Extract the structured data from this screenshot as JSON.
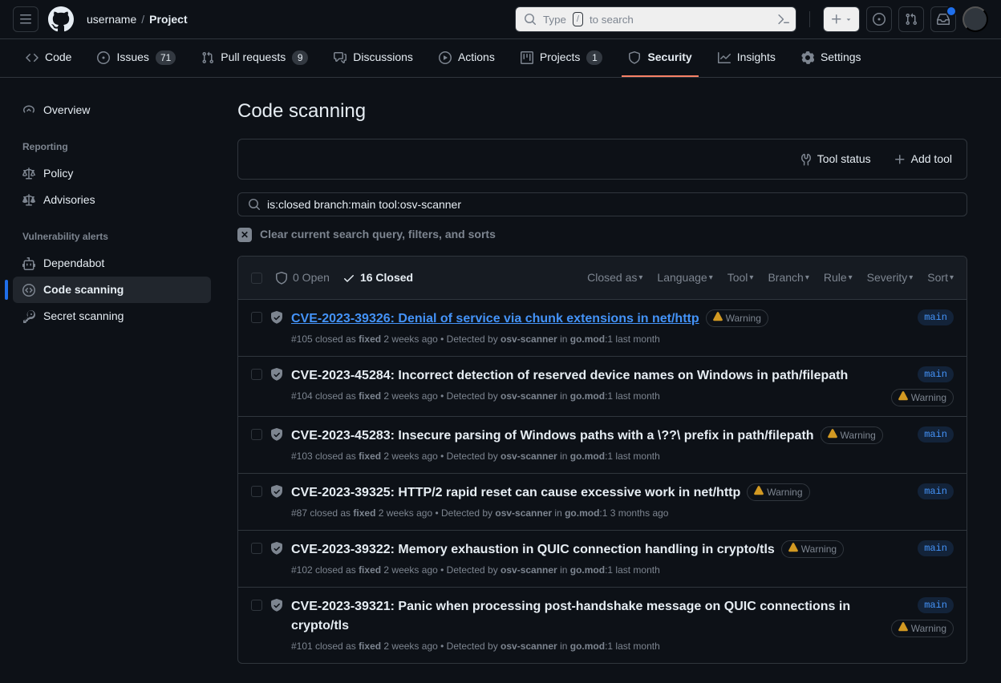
{
  "header": {
    "owner": "username",
    "repo": "Project",
    "search_prefix": "Type",
    "search_kbd": "/",
    "search_suffix": "to search"
  },
  "repoNav": [
    {
      "label": "Code",
      "count": null,
      "icon": "code"
    },
    {
      "label": "Issues",
      "count": "71",
      "icon": "issue"
    },
    {
      "label": "Pull requests",
      "count": "9",
      "icon": "pr"
    },
    {
      "label": "Discussions",
      "count": null,
      "icon": "discuss"
    },
    {
      "label": "Actions",
      "count": null,
      "icon": "play"
    },
    {
      "label": "Projects",
      "count": "1",
      "icon": "project"
    },
    {
      "label": "Security",
      "count": null,
      "icon": "shield",
      "active": true
    },
    {
      "label": "Insights",
      "count": null,
      "icon": "graph"
    },
    {
      "label": "Settings",
      "count": null,
      "icon": "gear"
    }
  ],
  "sidebar": {
    "overview": "Overview",
    "sections": [
      {
        "title": "Reporting",
        "items": [
          {
            "label": "Policy",
            "icon": "law"
          },
          {
            "label": "Advisories",
            "icon": "advisory"
          }
        ]
      },
      {
        "title": "Vulnerability alerts",
        "items": [
          {
            "label": "Dependabot",
            "icon": "dependabot"
          },
          {
            "label": "Code scanning",
            "icon": "codescan",
            "active": true
          },
          {
            "label": "Secret scanning",
            "icon": "key"
          }
        ]
      }
    ]
  },
  "page": {
    "title": "Code scanning",
    "toolbar": {
      "status": "Tool status",
      "add": "Add tool"
    },
    "search_value": "is:closed branch:main tool:osv-scanner",
    "clear_label": "Clear current search query, filters, and sorts",
    "states": {
      "open": "0 Open",
      "closed": "16 Closed"
    },
    "filters": [
      "Closed as",
      "Language",
      "Tool",
      "Branch",
      "Rule",
      "Severity",
      "Sort"
    ]
  },
  "alerts": [
    {
      "title": "CVE-2023-39326: Denial of service via chunk extensions in net/http",
      "link": true,
      "severity": "Warning",
      "branch": "main",
      "meta_num": "#105",
      "meta_state": "closed as",
      "meta_resolution": "fixed",
      "meta_when": "2 weeks ago",
      "meta_detected": "Detected by",
      "meta_tool": "osv-scanner",
      "meta_in": "in",
      "meta_file": "go.mod",
      "meta_file_suffix": ":1 last month"
    },
    {
      "title": "CVE-2023-45284: Incorrect detection of reserved device names on Windows in path/filepath",
      "severity": "Warning",
      "branch": "main",
      "meta_num": "#104",
      "meta_state": "closed as",
      "meta_resolution": "fixed",
      "meta_when": "2 weeks ago",
      "meta_detected": "Detected by",
      "meta_tool": "osv-scanner",
      "meta_in": "in",
      "meta_file": "go.mod",
      "meta_file_suffix": ":1 last month",
      "wrap": true
    },
    {
      "title": "CVE-2023-45283: Insecure parsing of Windows paths with a \\??\\ prefix in path/filepath",
      "severity": "Warning",
      "branch": "main",
      "meta_num": "#103",
      "meta_state": "closed as",
      "meta_resolution": "fixed",
      "meta_when": "2 weeks ago",
      "meta_detected": "Detected by",
      "meta_tool": "osv-scanner",
      "meta_in": "in",
      "meta_file": "go.mod",
      "meta_file_suffix": ":1 last month"
    },
    {
      "title": "CVE-2023-39325: HTTP/2 rapid reset can cause excessive work in net/http",
      "severity": "Warning",
      "branch": "main",
      "meta_num": "#87",
      "meta_state": "closed as",
      "meta_resolution": "fixed",
      "meta_when": "2 weeks ago",
      "meta_detected": "Detected by",
      "meta_tool": "osv-scanner",
      "meta_in": "in",
      "meta_file": "go.mod",
      "meta_file_suffix": ":1 3 months ago"
    },
    {
      "title": "CVE-2023-39322: Memory exhaustion in QUIC connection handling in crypto/tls",
      "severity": "Warning",
      "branch": "main",
      "meta_num": "#102",
      "meta_state": "closed as",
      "meta_resolution": "fixed",
      "meta_when": "2 weeks ago",
      "meta_detected": "Detected by",
      "meta_tool": "osv-scanner",
      "meta_in": "in",
      "meta_file": "go.mod",
      "meta_file_suffix": ":1 last month"
    },
    {
      "title": "CVE-2023-39321: Panic when processing post-handshake message on QUIC connections in crypto/tls",
      "severity": "Warning",
      "branch": "main",
      "meta_num": "#101",
      "meta_state": "closed as",
      "meta_resolution": "fixed",
      "meta_when": "2 weeks ago",
      "meta_detected": "Detected by",
      "meta_tool": "osv-scanner",
      "meta_in": "in",
      "meta_file": "go.mod",
      "meta_file_suffix": ":1 last month",
      "wrap": true
    }
  ]
}
